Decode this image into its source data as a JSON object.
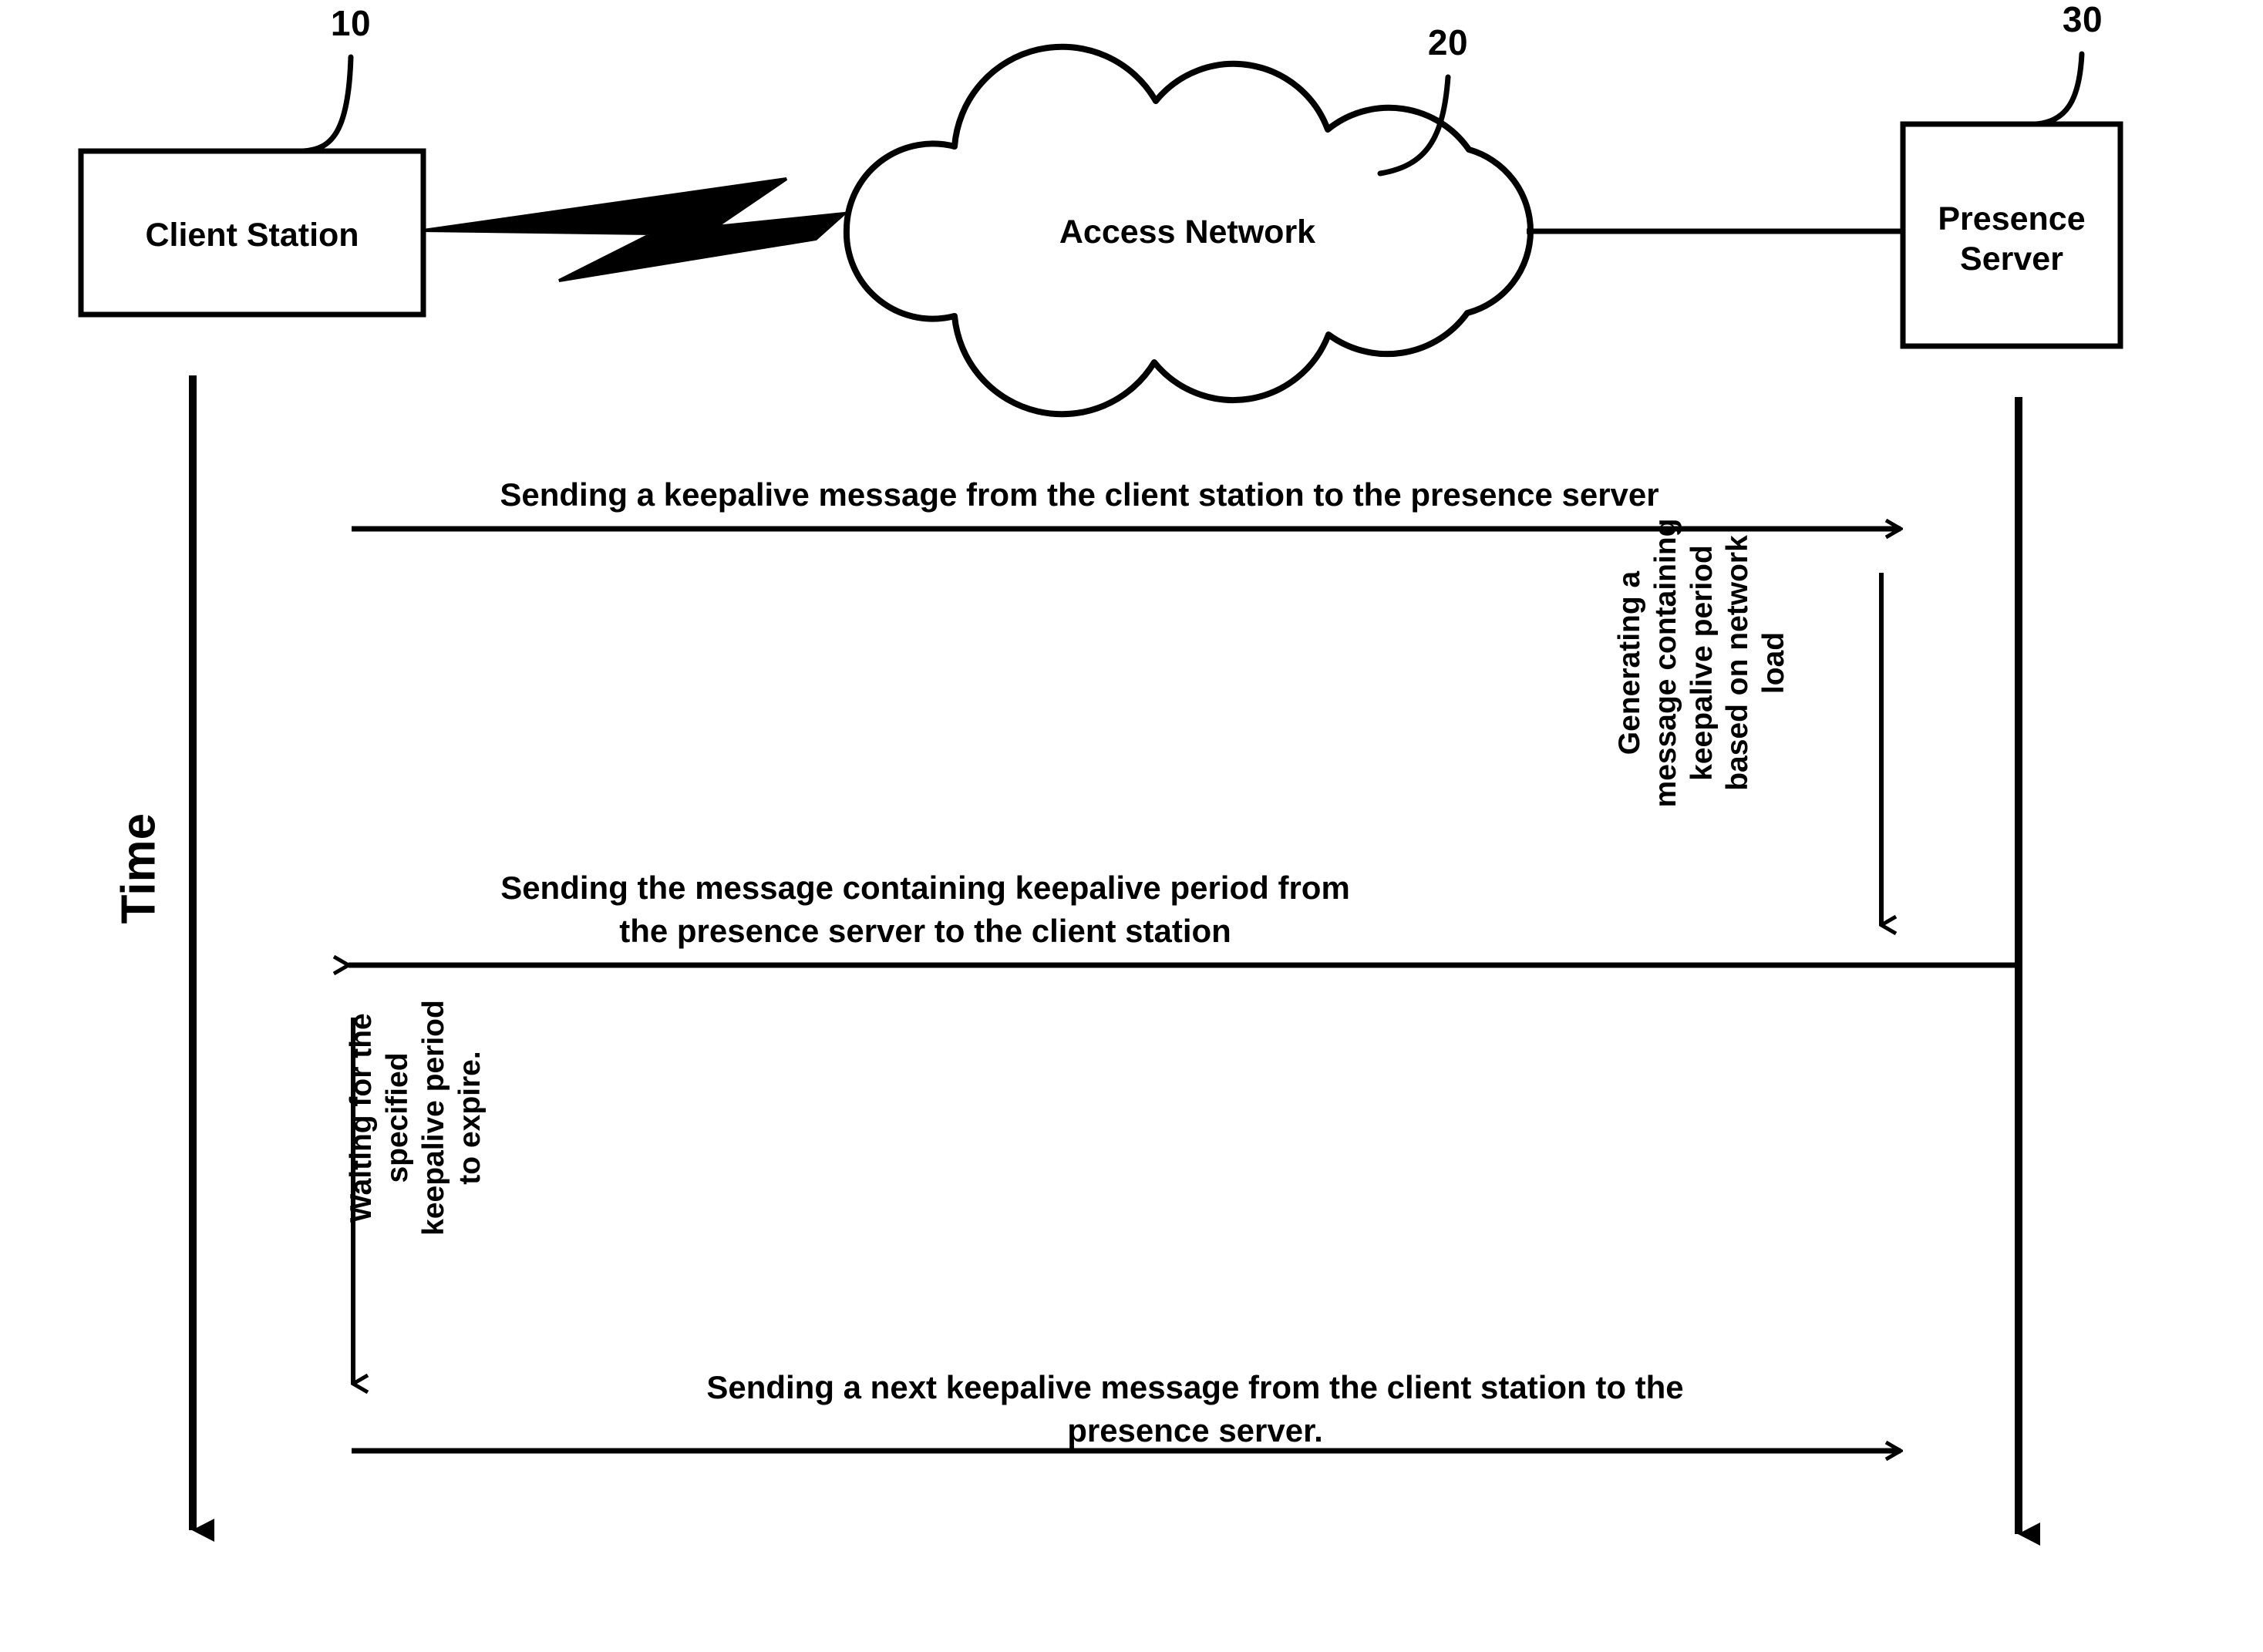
{
  "diagram": {
    "type": "sequence-diagram",
    "background_color": "#ffffff",
    "line_color": "#000000",
    "axis_label": "Time",
    "nodes": [
      {
        "id": "client",
        "label_line1": "Client Station",
        "label_line2": "",
        "ref_number": "10",
        "shape": "rectangle"
      },
      {
        "id": "network",
        "label_line1": "Access Network",
        "label_line2": "",
        "ref_number": "20",
        "shape": "cloud"
      },
      {
        "id": "server",
        "label_line1": "Presence",
        "label_line2": "Server",
        "ref_number": "30",
        "shape": "rectangle"
      }
    ],
    "connectors": [
      {
        "from": "client",
        "to": "network",
        "style": "lightning-bolt"
      },
      {
        "from": "network",
        "to": "server",
        "style": "straight-line"
      }
    ],
    "messages": [
      {
        "id": "msg1",
        "direction": "client-to-server",
        "text_line1": "Sending a keepalive message from the client station to the presence server",
        "text_line2": ""
      },
      {
        "id": "msg2",
        "direction": "server-to-client",
        "text_line1": "Sending the message containing keepalive period from",
        "text_line2": "the presence server to the client station"
      },
      {
        "id": "msg3",
        "direction": "client-to-server",
        "text_line1": "Sending a next keepalive message from the client station to the",
        "text_line2": "presence server."
      }
    ],
    "activities": [
      {
        "id": "act-server",
        "on": "server",
        "orientation": "vertical-rotated",
        "text": "Generating a\nmessage containing\nkeepalive period\nbased on network\nload"
      },
      {
        "id": "act-client",
        "on": "client",
        "orientation": "vertical-rotated",
        "text": "Waiting for the\nspecified\nkeepalive period\nto expire."
      }
    ]
  }
}
